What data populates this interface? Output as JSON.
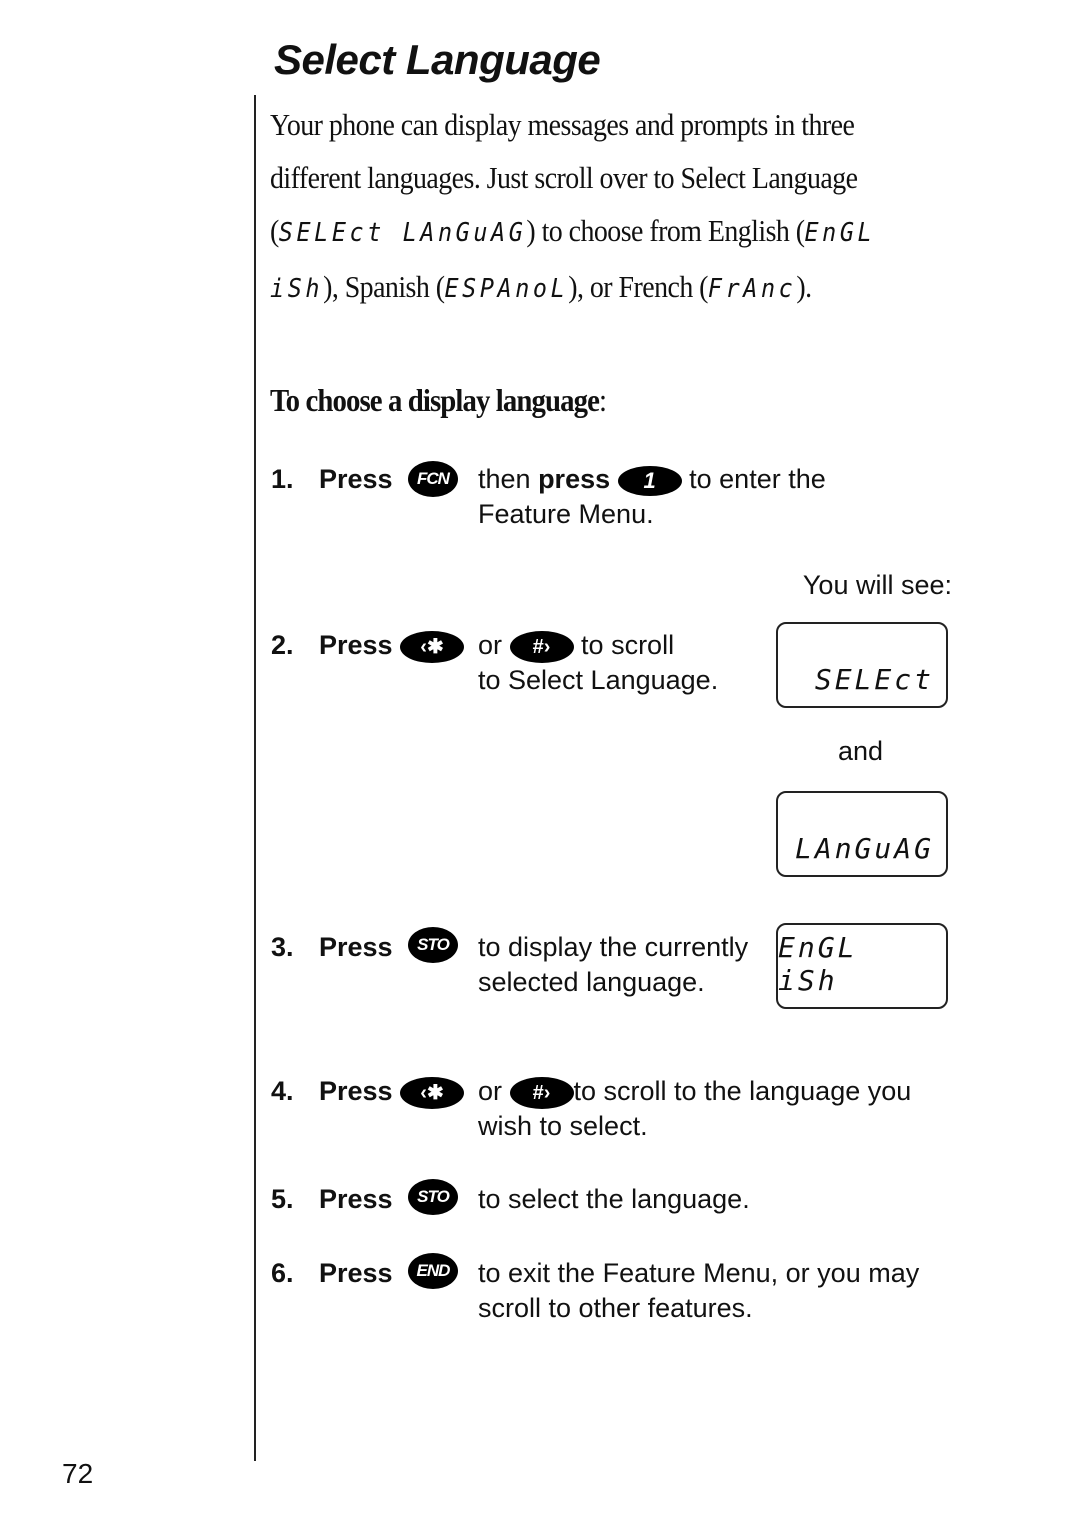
{
  "page": {
    "title": "Select Language",
    "page_number": "72"
  },
  "intro": {
    "text_1": "Your phone can display messages and prompts in three different languages. Just scroll over to Select Language (",
    "lcd_select_language": "SELEct LAnGuAG",
    "text_2": ") to choose from English (",
    "lcd_english": "EnGL iSh",
    "text_3": "), Spanish (",
    "lcd_spanish": "ESPAnoL",
    "text_4": "), or French (",
    "lcd_french": "FrAnc",
    "text_5": ")."
  },
  "subheading": {
    "text": "To choose a display language",
    "colon": ":"
  },
  "keys": {
    "fcn": "FCN",
    "one": "1",
    "star": "‹✱",
    "hash": "#›",
    "sto": "STO",
    "end": "END"
  },
  "steps": [
    {
      "num": "1.",
      "press": "Press",
      "text_a": "then ",
      "text_bold": "press",
      "text_b": " to enter the",
      "text_c": "Feature Menu."
    },
    {
      "num": "2.",
      "press": "Press",
      "or": "or",
      "text_a": "to scroll",
      "text_b": "to Select Language."
    },
    {
      "num": "3.",
      "press": "Press",
      "text_a": "to display the currently",
      "text_b": "selected language."
    },
    {
      "num": "4.",
      "press": "Press",
      "or": "or",
      "text_a": "to scroll to the language you",
      "text_b": "wish to select."
    },
    {
      "num": "5.",
      "press": "Press",
      "text_a": "to select the language."
    },
    {
      "num": "6.",
      "press": "Press",
      "text_a": "to exit the Feature Menu, or you may",
      "text_b": "scroll to other features."
    }
  ],
  "displays": {
    "you_will_see": "You will see:",
    "and": "and",
    "screen_1": "SELEct",
    "screen_2": "LAnGuAG",
    "screen_3": "EnGL iSh"
  }
}
